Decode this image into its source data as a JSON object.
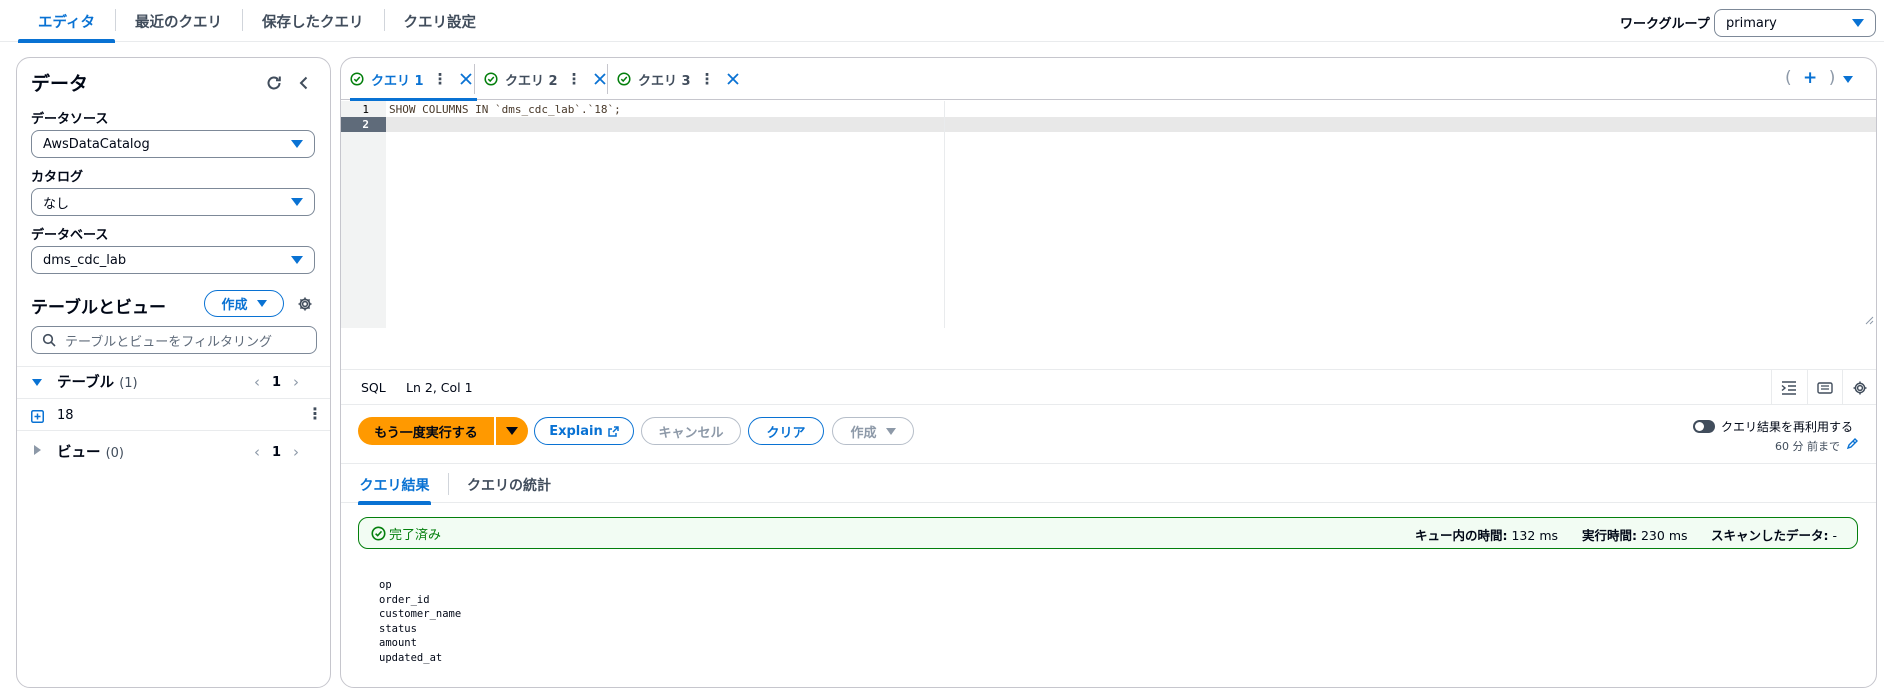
{
  "top_tabs": [
    "エディタ",
    "最近のクエリ",
    "保存したクエリ",
    "クエリ設定"
  ],
  "workgroup": {
    "label": "ワークグループ",
    "value": "primary"
  },
  "data_panel": {
    "title": "データ",
    "data_source": {
      "label": "データソース",
      "value": "AwsDataCatalog"
    },
    "catalog": {
      "label": "カタログ",
      "value": "なし"
    },
    "database": {
      "label": "データベース",
      "value": "dms_cdc_lab"
    },
    "tables_and_views": {
      "title": "テーブルとビュー",
      "create_label": "作成",
      "filter_placeholder": "テーブルとビューをフィルタリング"
    },
    "tables": {
      "label": "テーブル",
      "count": "(1)",
      "page": "1",
      "items": [
        "18"
      ]
    },
    "views": {
      "label": "ビュー",
      "count": "(0)",
      "page": "1"
    }
  },
  "query_tabs": [
    "クエリ 1",
    "クエリ 2",
    "クエリ 3"
  ],
  "editor": {
    "line_numbers": [
      "1",
      "2"
    ],
    "code_line_1": "SHOW COLUMNS IN `dms_cdc_lab`.`18`;"
  },
  "status_bar": {
    "language": "SQL",
    "position": "Ln 2, Col 1"
  },
  "actions": {
    "run_again": "もう一度実行する",
    "explain": "Explain",
    "cancel": "キャンセル",
    "clear": "クリア",
    "create": "作成"
  },
  "reuse": {
    "label": "クエリ結果を再利用する",
    "sub": "60 分 前まで"
  },
  "result_tabs": [
    "クエリ結果",
    "クエリの統計"
  ],
  "result_status": {
    "status": "完了済み",
    "queue_time_label": "キュー内の時間:",
    "queue_time_value": "132 ms",
    "run_time_label": "実行時間:",
    "run_time_value": "230 ms",
    "scanned_label": "スキャンしたデータ:",
    "scanned_value": "-"
  },
  "results": [
    "op",
    "order_id",
    "customer_name",
    "status",
    "amount",
    "updated_at"
  ],
  "colors": {
    "accent": "#0972d3",
    "primary_button": "#ff9900",
    "success": "#037f0c"
  }
}
